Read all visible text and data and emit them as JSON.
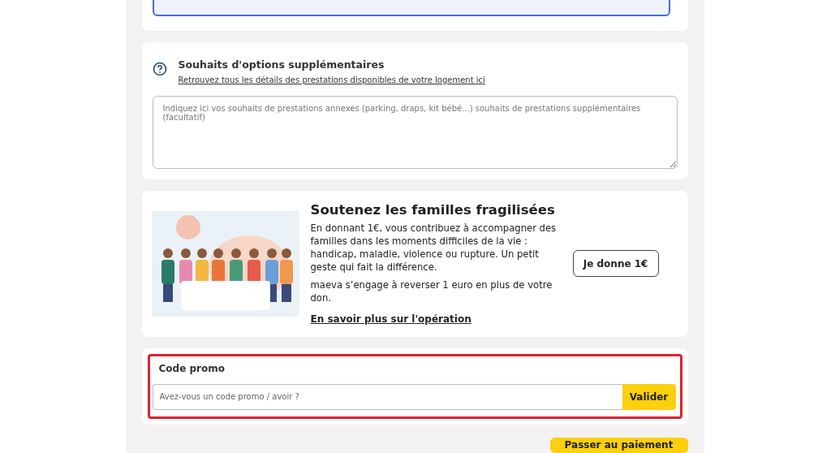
{
  "options": {
    "title": "Souhaits d'options supplémentaires",
    "link": "Retrouvez tous les détails des prestations disponibles de votre logement ici",
    "placeholder": "Indiquez ici vos souhaits de prestations annexes (parking, draps, kit bébé...) souhaits de prestations supplémentaires (facultatif)"
  },
  "donation": {
    "title": "Soutenez les familles fragilisées",
    "body": "En donnant 1€, vous contribuez à accompagner des familles dans les moments difficiles de la vie : handicap, maladie, violence ou rupture. Un petit geste qui fait la différence.",
    "note": "maeva s’engage à reverser 1 euro en plus de votre don.",
    "link": "En savoir plus sur l'opération",
    "button": "Je donne 1€"
  },
  "promo": {
    "title": "Code promo",
    "highlighted": true,
    "placeholder": "Avez-vous un code promo / avoir ?",
    "button": "Valider"
  },
  "checkout_button": "Passer au paiement"
}
